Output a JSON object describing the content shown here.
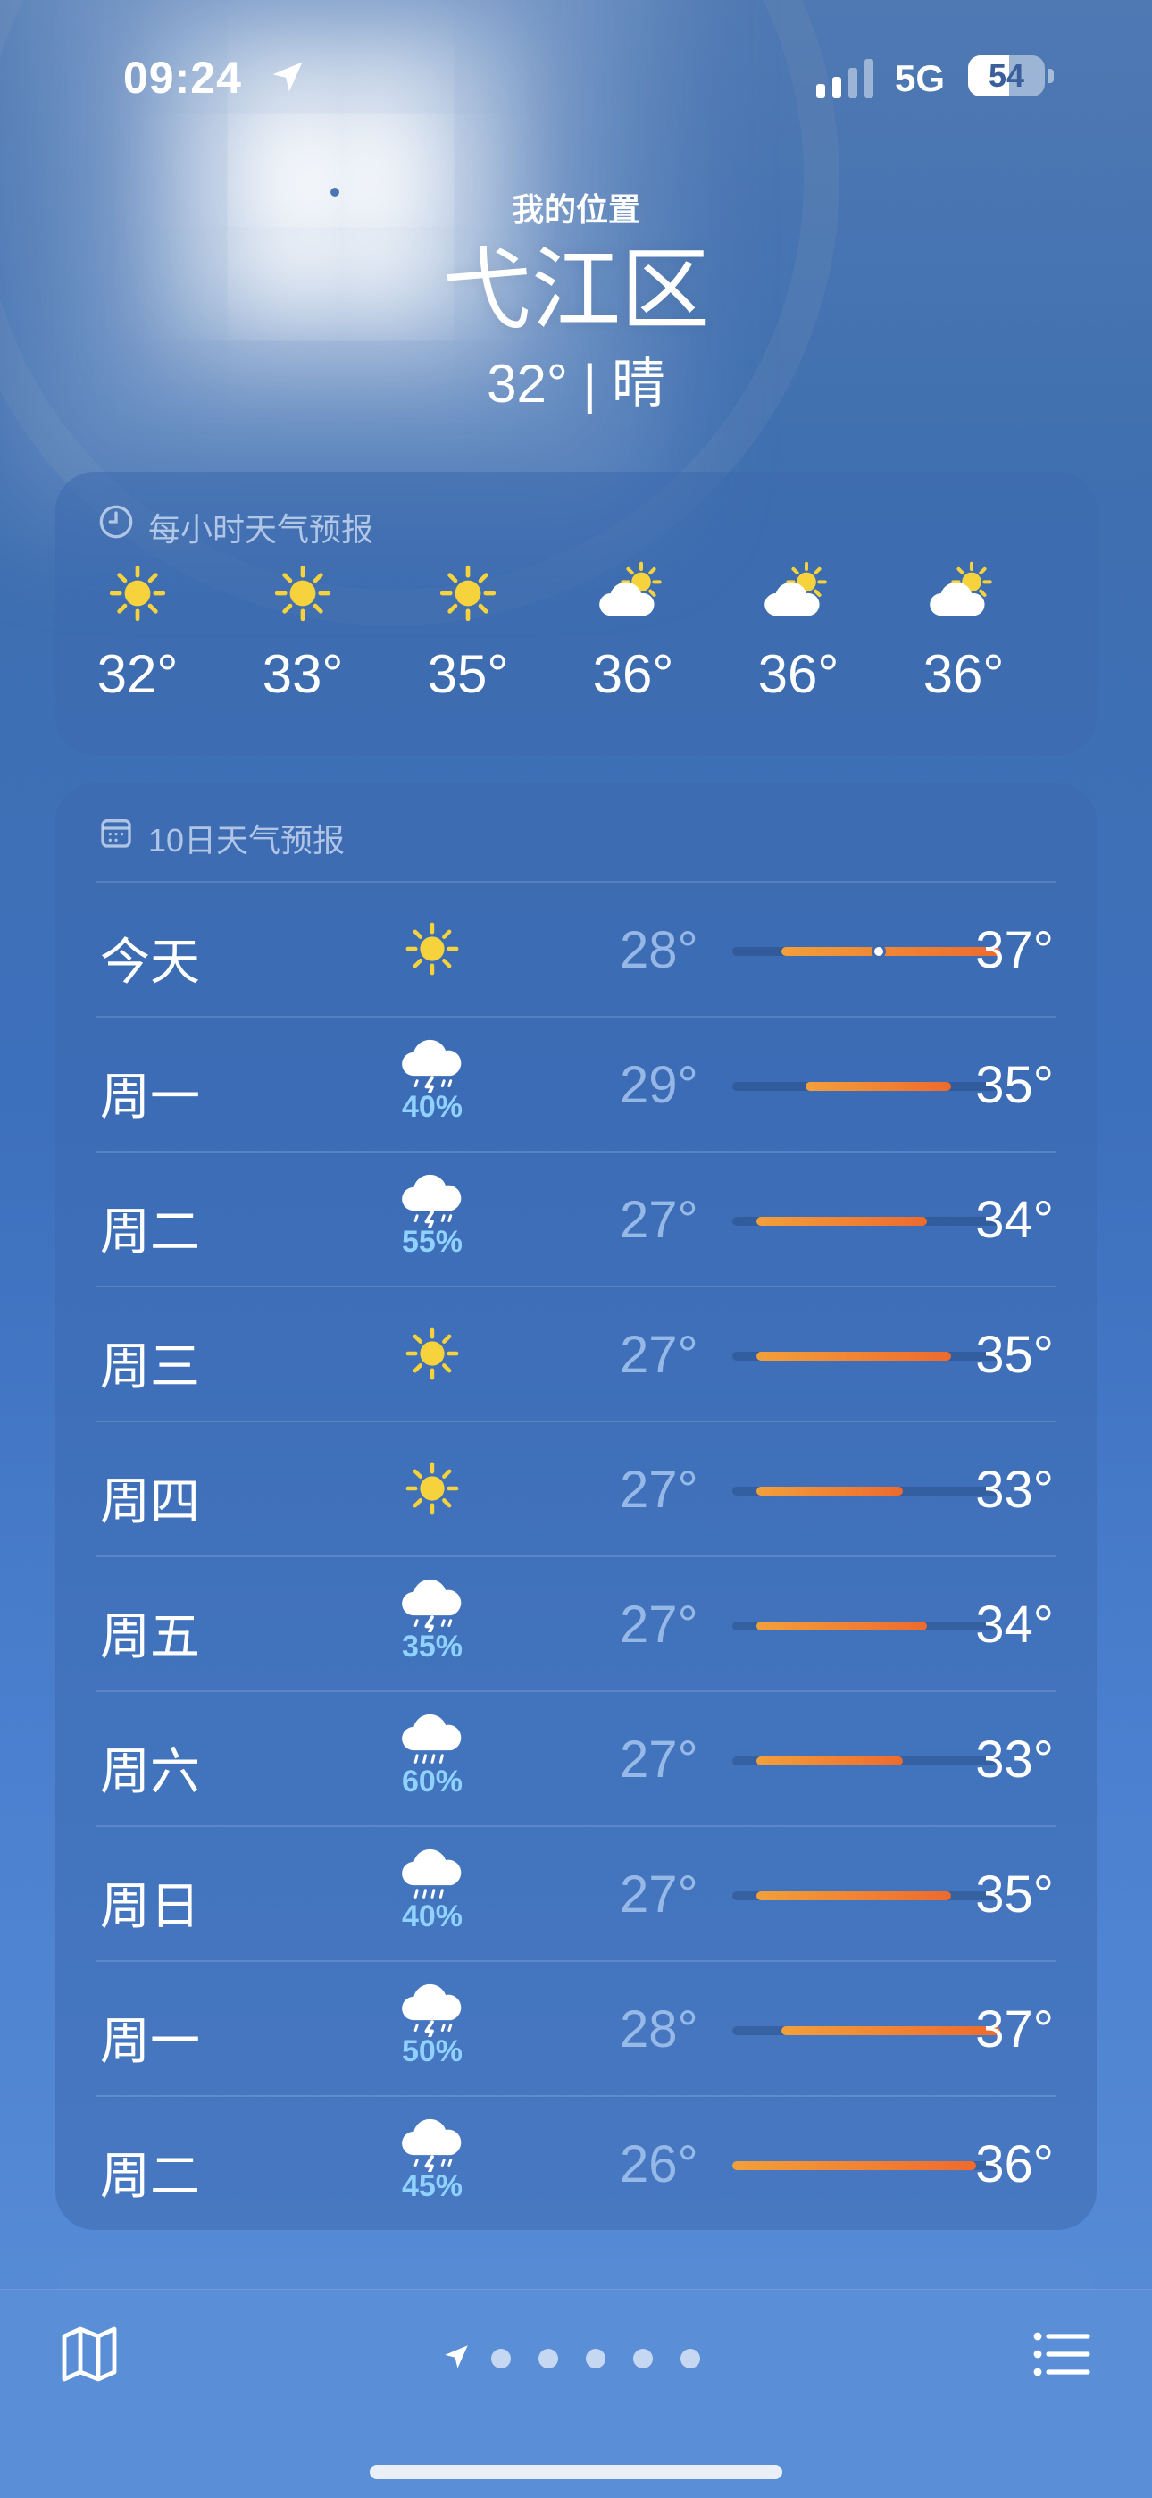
{
  "status_bar": {
    "time": "09:24",
    "network": "5G",
    "battery": "54",
    "battery_level": 0.54
  },
  "header": {
    "location_label": "我的位置",
    "city": "弋江区",
    "current": "32° | 晴"
  },
  "hourly": {
    "title": "每小时天气预报",
    "items": [
      {
        "icon": "sun-icon",
        "temp": "32°"
      },
      {
        "icon": "sun-icon",
        "temp": "33°"
      },
      {
        "icon": "sun-icon",
        "temp": "35°"
      },
      {
        "icon": "partly-cloudy-icon",
        "temp": "36°"
      },
      {
        "icon": "partly-cloudy-icon",
        "temp": "36°"
      },
      {
        "icon": "partly-cloudy-icon",
        "temp": "36°"
      }
    ]
  },
  "daily": {
    "title": "10日天气预报",
    "range_min": 26,
    "range_max": 37,
    "days": [
      {
        "day": "今天",
        "icon": "sun-icon",
        "pct": "",
        "low": "28°",
        "high": "37°",
        "low_v": 28,
        "high_v": 37,
        "current": 32
      },
      {
        "day": "周一",
        "icon": "thunderstorm-icon",
        "pct": "40%",
        "low": "29°",
        "high": "35°",
        "low_v": 29,
        "high_v": 35
      },
      {
        "day": "周二",
        "icon": "thunderstorm-icon",
        "pct": "55%",
        "low": "27°",
        "high": "34°",
        "low_v": 27,
        "high_v": 34
      },
      {
        "day": "周三",
        "icon": "sun-icon",
        "pct": "",
        "low": "27°",
        "high": "35°",
        "low_v": 27,
        "high_v": 35
      },
      {
        "day": "周四",
        "icon": "sun-icon",
        "pct": "",
        "low": "27°",
        "high": "33°",
        "low_v": 27,
        "high_v": 33
      },
      {
        "day": "周五",
        "icon": "thunderstorm-icon",
        "pct": "35%",
        "low": "27°",
        "high": "34°",
        "low_v": 27,
        "high_v": 34
      },
      {
        "day": "周六",
        "icon": "rain-icon",
        "pct": "60%",
        "low": "27°",
        "high": "33°",
        "low_v": 27,
        "high_v": 33
      },
      {
        "day": "周日",
        "icon": "rain-icon",
        "pct": "40%",
        "low": "27°",
        "high": "35°",
        "low_v": 27,
        "high_v": 35
      },
      {
        "day": "周一",
        "icon": "thunderstorm-icon",
        "pct": "50%",
        "low": "28°",
        "high": "37°",
        "low_v": 28,
        "high_v": 37
      },
      {
        "day": "周二",
        "icon": "thunderstorm-icon",
        "pct": "45%",
        "low": "26°",
        "high": "36°",
        "low_v": 26,
        "high_v": 36
      }
    ]
  },
  "bottom_bar": {
    "page_count": 5,
    "icons": [
      "map-icon",
      "location-arrow-icon",
      "list-icon"
    ]
  },
  "colors": {
    "accent_orange": "#ee6a2e",
    "precip_blue": "#8fd2ff",
    "sun_yellow": "#f6d33c"
  }
}
